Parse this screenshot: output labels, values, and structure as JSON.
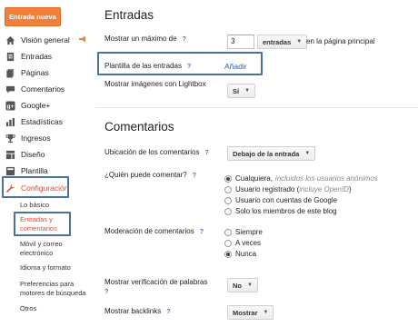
{
  "sidebar": {
    "new_entry_button": "Entrada nueva",
    "items": [
      {
        "label": "Visión general",
        "icon": "home-icon"
      },
      {
        "label": "Entradas",
        "icon": "document-icon"
      },
      {
        "label": "Páginas",
        "icon": "page-icon"
      },
      {
        "label": "Comentarios",
        "icon": "comment-icon"
      },
      {
        "label": "Google+",
        "icon": "google-plus-icon"
      },
      {
        "label": "Estadísticas",
        "icon": "stats-icon"
      },
      {
        "label": "Ingresos",
        "icon": "trophy-icon"
      },
      {
        "label": "Diseño",
        "icon": "layout-icon"
      },
      {
        "label": "Plantilla",
        "icon": "template-icon"
      },
      {
        "label": "Configuración",
        "icon": "wrench-icon"
      }
    ],
    "sub_items": [
      {
        "label": "Lo básico"
      },
      {
        "label": "Entradas y comentarios"
      },
      {
        "label": "Móvil y correo electrónico"
      },
      {
        "label": "Idioma y formato"
      },
      {
        "label": "Preferencias para motores de búsqueda"
      },
      {
        "label": "Otros"
      }
    ],
    "accent_color": "#dd4b39"
  },
  "entradas": {
    "title": "Entradas",
    "max_label": "Mostrar un máximo de",
    "max_value": "3",
    "max_unit": "entradas",
    "max_suffix": "en la página principal",
    "template_label": "Plantilla de las entradas",
    "template_link": "Añadir",
    "lightbox_label": "Mostrar imágenes con Lightbox",
    "lightbox_value": "Sí",
    "help": "?"
  },
  "comentarios": {
    "title": "Comentarios",
    "location_label": "Ubicación de los comentarios",
    "location_value": "Debajo de la entrada",
    "who_label": "¿Quién puede comentar?",
    "who_options": [
      {
        "label": "Cualquiera,",
        "hint": "incluidos los usuarios anónimos",
        "checked": true
      },
      {
        "label": "Usuario registrado (",
        "hint": "incluye OpenID",
        "tail": ")",
        "checked": false
      },
      {
        "label": "Usuario con cuentas de Google",
        "hint": "",
        "checked": false
      },
      {
        "label": "Solo los miembros de este blog",
        "hint": "",
        "checked": false
      }
    ],
    "moderation_label": "Moderación de comentarios",
    "moderation_options": [
      {
        "label": "Siempre",
        "checked": false
      },
      {
        "label": "A veces",
        "checked": false
      },
      {
        "label": "Nunca",
        "checked": true
      }
    ],
    "verification_label": "Mostrar verificación de palabras",
    "verification_value": "No",
    "backlinks_label": "Mostrar backlinks",
    "backlinks_value": "Mostrar"
  },
  "colors": {
    "orange_button": "#f0803a",
    "link_blue": "#2a5db0",
    "highlight_box": "#4a6fa3"
  }
}
